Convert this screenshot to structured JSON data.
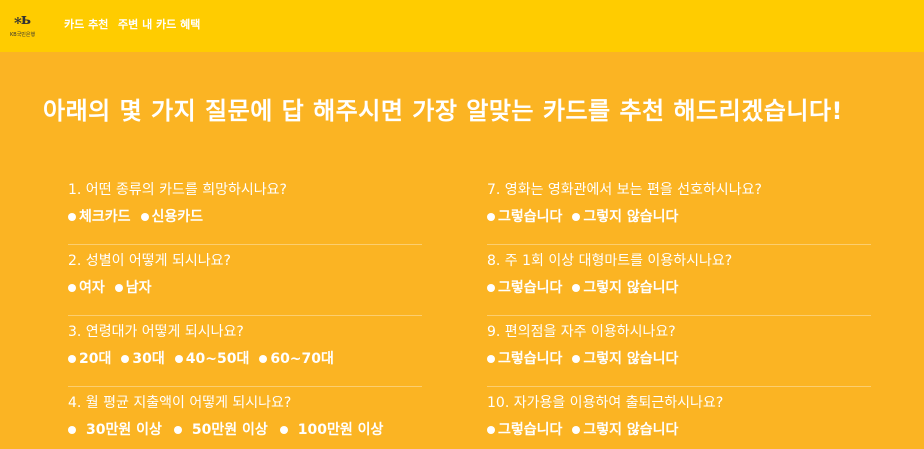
{
  "header": {
    "logo_mark": "⁎ь",
    "logo_text": "KB국민은행",
    "nav": [
      "카드 추천",
      "주변 내 카드 혜택"
    ]
  },
  "headline": "아래의 몇 가지 질문에 답 해주시면 가장 알맞는 카드를 추천 해드리겠습니다!",
  "questions_left": [
    {
      "text": "1. 어떤 종류의 카드를 희망하시나요?",
      "options": [
        "체크카드",
        "신용카드"
      ]
    },
    {
      "text": "2. 성별이 어떻게 되시나요?",
      "options": [
        "여자",
        "남자"
      ]
    },
    {
      "text": "3. 연령대가 어떻게 되시나요?",
      "options": [
        "20대",
        "30대",
        "40~50대",
        "60~70대"
      ]
    },
    {
      "text": "4. 월 평균 지출액이 어떻게 되시나요?",
      "options": [
        "30만원 이상",
        "50만원 이상",
        "100만원 이상"
      ]
    }
  ],
  "questions_right": [
    {
      "text": "7. 영화는 영화관에서 보는 편을 선호하시나요?",
      "options": [
        "그렇습니다",
        "그렇지 않습니다"
      ]
    },
    {
      "text": "8. 주 1회 이상 대형마트를 이용하시나요?",
      "options": [
        "그렇습니다",
        "그렇지 않습니다"
      ]
    },
    {
      "text": "9. 편의점을 자주 이용하시나요?",
      "options": [
        "그렇습니다",
        "그렇지 않습니다"
      ]
    },
    {
      "text": "10. 자가용을 이용하여 출퇴근하시나요?",
      "options": [
        "그렇습니다",
        "그렇지 않습니다"
      ]
    }
  ]
}
